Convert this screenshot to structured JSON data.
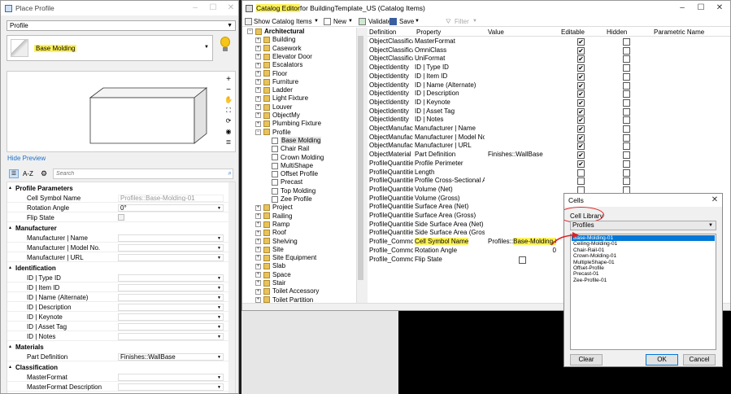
{
  "place_profile": {
    "title": "Place Profile",
    "type_value": "Profile",
    "selected_profile": "Base Molding",
    "hide_preview": "Hide Preview",
    "toolbar_az": "A-Z",
    "search_placeholder": "Search",
    "sections": [
      {
        "title": "Profile Parameters",
        "rows": [
          {
            "name": "Cell Symbol Name",
            "value": "Profiles::Base-Molding-01",
            "disabled": true
          },
          {
            "name": "Rotation Angle",
            "value": "0°"
          },
          {
            "name": "Flip State",
            "value": "",
            "checkbox": true
          }
        ]
      },
      {
        "title": "Manufacturer",
        "rows": [
          {
            "name": "Manufacturer | Name",
            "value": ""
          },
          {
            "name": "Manufacturer | Model No.",
            "value": ""
          },
          {
            "name": "Manufacturer | URL",
            "value": ""
          }
        ]
      },
      {
        "title": "Identification",
        "rows": [
          {
            "name": "ID | Type ID",
            "value": ""
          },
          {
            "name": "ID | Item ID",
            "value": ""
          },
          {
            "name": "ID | Name (Alternate)",
            "value": ""
          },
          {
            "name": "ID | Description",
            "value": ""
          },
          {
            "name": "ID | Keynote",
            "value": ""
          },
          {
            "name": "ID | Asset Tag",
            "value": ""
          },
          {
            "name": "ID | Notes",
            "value": ""
          }
        ]
      },
      {
        "title": "Materials",
        "rows": [
          {
            "name": "Part Definition",
            "value": "Finishes::WallBase"
          }
        ]
      },
      {
        "title": "Classification",
        "rows": [
          {
            "name": "MasterFormat",
            "value": ""
          },
          {
            "name": "MasterFormat Description",
            "value": ""
          }
        ]
      }
    ]
  },
  "catalog_editor": {
    "title_highlight": "Catalog Editor",
    "title_rest": " for BuildingTemplate_US (Catalog Items)",
    "toolbar": {
      "show_catalog_items": "Show Catalog Items",
      "new": "New",
      "validate": "Validate",
      "save": "Save",
      "filter": "Filter"
    },
    "tree": {
      "root": "Architectural",
      "items": [
        "Building",
        "Casework",
        "Elevator Door",
        "Escalators",
        "Floor",
        "Furniture",
        "Ladder",
        "Light Fixture",
        "Louver",
        "ObjectMy",
        "Plumbing Fixture",
        "Profile"
      ],
      "profile_children": [
        "Base Molding",
        "Chair Rail",
        "Crown Molding",
        "MultiShape",
        "Offset Profile",
        "Precast",
        "Top Molding",
        "Zee Profile"
      ],
      "items_after": [
        "Project",
        "Railing",
        "Ramp",
        "Roof",
        "Shelving",
        "Site",
        "Site Equipment",
        "Slab",
        "Space",
        "Stair",
        "Toilet Accessory",
        "Toilet Partition"
      ]
    },
    "columns": [
      "Definition",
      "Property",
      "Value",
      "Editable",
      "Hidden",
      "Parametric Name"
    ],
    "rows": [
      {
        "def": "ObjectClassification",
        "prop": "MasterFormat",
        "value": "",
        "editable": true,
        "hidden": false
      },
      {
        "def": "ObjectClassification",
        "prop": "OmniClass",
        "value": "",
        "editable": true,
        "hidden": false
      },
      {
        "def": "ObjectClassification",
        "prop": "UniFormat",
        "value": "",
        "editable": true,
        "hidden": false
      },
      {
        "def": "ObjectIdentity",
        "prop": "ID | Type ID",
        "value": "",
        "editable": true,
        "hidden": false
      },
      {
        "def": "ObjectIdentity",
        "prop": "ID | Item ID",
        "value": "",
        "editable": true,
        "hidden": false
      },
      {
        "def": "ObjectIdentity",
        "prop": "ID | Name (Alternate)",
        "value": "",
        "editable": true,
        "hidden": false
      },
      {
        "def": "ObjectIdentity",
        "prop": "ID | Description",
        "value": "",
        "editable": true,
        "hidden": false
      },
      {
        "def": "ObjectIdentity",
        "prop": "ID | Keynote",
        "value": "",
        "editable": true,
        "hidden": false
      },
      {
        "def": "ObjectIdentity",
        "prop": "ID | Asset Tag",
        "value": "",
        "editable": true,
        "hidden": false
      },
      {
        "def": "ObjectIdentity",
        "prop": "ID | Notes",
        "value": "",
        "editable": true,
        "hidden": false
      },
      {
        "def": "ObjectManufacturer",
        "prop": "Manufacturer | Name",
        "value": "",
        "editable": true,
        "hidden": false
      },
      {
        "def": "ObjectManufacturer",
        "prop": "Manufacturer | Model No.",
        "value": "",
        "editable": true,
        "hidden": false
      },
      {
        "def": "ObjectManufacturer",
        "prop": "Manufacturer | URL",
        "value": "",
        "editable": true,
        "hidden": false
      },
      {
        "def": "ObjectMaterial",
        "prop": "Part Definition",
        "value": "Finishes::WallBase",
        "editable": true,
        "hidden": false
      },
      {
        "def": "ProfileQuantities",
        "prop": "Profile Perimeter",
        "value": "",
        "editable": true,
        "hidden": false
      },
      {
        "def": "ProfileQuantities",
        "prop": "Length",
        "value": "",
        "editable": false,
        "hidden": false
      },
      {
        "def": "ProfileQuantities",
        "prop": "Profile Cross-Sectional Area",
        "value": "",
        "editable": false,
        "hidden": false
      },
      {
        "def": "ProfileQuantities",
        "prop": "Volume (Net)",
        "value": "",
        "editable": false,
        "hidden": false
      },
      {
        "def": "ProfileQuantities",
        "prop": "Volume (Gross)",
        "value": "",
        "editable": false,
        "hidden": false
      },
      {
        "def": "ProfileQuantities",
        "prop": "Surface Area (Net)",
        "value": "",
        "editable": false,
        "hidden": false
      },
      {
        "def": "ProfileQuantities",
        "prop": "Surface Area (Gross)",
        "value": "",
        "editable": false,
        "hidden": false
      },
      {
        "def": "ProfileQuantities",
        "prop": "Side Surface Area (Net)",
        "value": "",
        "editable": false,
        "hidden": false
      },
      {
        "def": "ProfileQuantities",
        "prop": "Side Surface Area (Gross)",
        "value": "",
        "editable": false,
        "hidden": false
      },
      {
        "def": "Profile_Common",
        "prop": "Cell Symbol Name",
        "value": "Profiles::Base-Molding-01",
        "editable": false,
        "hidden": false,
        "highlight": true
      },
      {
        "def": "Profile_Common",
        "prop": "Rotation Angle",
        "value": "0",
        "editable": false,
        "hidden": false
      },
      {
        "def": "Profile_Common",
        "prop": "Flip State",
        "value": "",
        "editable": false,
        "hidden": false,
        "valuecheck": true
      }
    ]
  },
  "cells_dialog": {
    "title": "Cells",
    "library_label": "Cell Library",
    "library_value": "Profiles",
    "items": [
      "Base-Molding-01",
      "Ceiling-Molding-01",
      "Chair-Rail-01",
      "Crown-Molding-01",
      "MultipleShape-01",
      "Offset-Profile",
      "Precast-01",
      "Zee-Profile-01"
    ],
    "clear": "Clear",
    "ok": "OK",
    "cancel": "Cancel"
  },
  "colors": {
    "highlight": "#fff35a",
    "selection": "#0078d7",
    "annotation": "#e02020",
    "accent": "#1e6fc8"
  }
}
